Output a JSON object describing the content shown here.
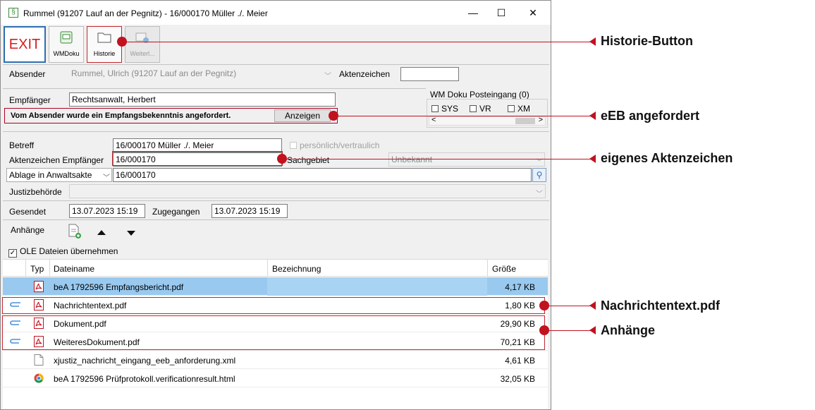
{
  "window": {
    "title": "Rummel (91207 Lauf an der Pegnitz) - 16/000170 Müller ./. Meier",
    "app_icon_glyph": "§",
    "minimize_glyph": "—",
    "maximize_glyph": "☐",
    "close_glyph": "✕"
  },
  "toolbar": {
    "exit_label": "EXIT",
    "wmdoku_label": "WMDoku",
    "historie_label": "Historie",
    "weiter_label": "Weiterl..."
  },
  "absender": {
    "label": "Absender",
    "value": "Rummel, Ulrich (91207 Lauf an der Pegnitz)",
    "aktenzeichen_label": "Aktenzeichen",
    "aktenzeichen_value": ""
  },
  "empfaenger": {
    "label": "Empfänger",
    "value": "Rechtsanwalt, Herbert"
  },
  "eeb": {
    "message": "Vom Absender wurde ein Empfangsbekenntnis angefordert.",
    "button_label": "Anzeigen"
  },
  "wm_posteingang": {
    "title": "WM Doku Posteingang (0)",
    "options": [
      "SYS",
      "VR",
      "XM"
    ],
    "scroll_left": "<",
    "scroll_right": ">"
  },
  "details": {
    "betreff_label": "Betreff",
    "betreff_value": "16/000170 Müller ./. Meier",
    "persoenlich_label": "persönlich/vertraulich",
    "az_empf_label": "Aktenzeichen Empfänger",
    "az_empf_value": "16/000170",
    "sachgebiet_label": "Sachgebiet",
    "sachgebiet_value": "Unbekannt",
    "ablage_label": "Ablage in Anwaltsakte",
    "ablage_value": "16/000170",
    "justiz_label": "Justizbehörde",
    "justiz_value": ""
  },
  "dates": {
    "gesendet_label": "Gesendet",
    "gesendet_value": "13.07.2023 15:19",
    "zugegangen_label": "Zugegangen",
    "zugegangen_value": "13.07.2023 15:19"
  },
  "anhaenge": {
    "label": "Anhänge",
    "ole_label": "OLE Dateien übernehmen",
    "ole_checked": true
  },
  "table": {
    "headers": {
      "typ": "Typ",
      "dateiname": "Dateiname",
      "bezeichnung": "Bezeichnung",
      "groesse": "Größe"
    },
    "rows": [
      {
        "clip": false,
        "type": "pdf",
        "name": "beA 1792596 Empfangsbericht.pdf",
        "bezeichnung": "",
        "size": "4,17 KB",
        "selected": true
      },
      {
        "clip": true,
        "type": "pdf",
        "name": "Nachrichtentext.pdf",
        "bezeichnung": "",
        "size": "1,80 KB",
        "selected": false
      },
      {
        "clip": true,
        "type": "pdf",
        "name": "Dokument.pdf",
        "bezeichnung": "",
        "size": "29,90 KB",
        "selected": false
      },
      {
        "clip": true,
        "type": "pdf",
        "name": "WeiteresDokument.pdf",
        "bezeichnung": "",
        "size": "70,21 KB",
        "selected": false
      },
      {
        "clip": false,
        "type": "file",
        "name": "xjustiz_nachricht_eingang_eeb_anforderung.xml",
        "bezeichnung": "",
        "size": "4,61 KB",
        "selected": false
      },
      {
        "clip": false,
        "type": "chrome",
        "name": "beA 1792596 Prüfprotokoll.verificationresult.html",
        "bezeichnung": "",
        "size": "32,05 KB",
        "selected": false
      }
    ]
  },
  "callouts": {
    "historie": "Historie-Button",
    "eeb": "eEB angefordert",
    "aktenzeichen": "eigenes Aktenzeichen",
    "nachrichtentext": "Nachrichtentext.pdf",
    "anhaenge": "Anhänge"
  },
  "colors": {
    "accent_red": "#c1121f",
    "selection_blue": "#99c9ef",
    "exit_red": "#d21f1f"
  }
}
